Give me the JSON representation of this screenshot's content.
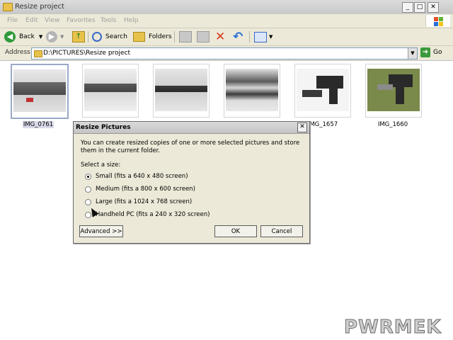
{
  "window": {
    "title": "Resize project",
    "btn_min": "_",
    "btn_max": "□",
    "btn_close": "✕"
  },
  "menu": [
    "File",
    "Edit",
    "View",
    "Favorites",
    "Tools",
    "Help"
  ],
  "toolbar": {
    "back_label": "Back",
    "search_label": "Search",
    "folders_label": "Folders"
  },
  "address": {
    "label": "Address",
    "path": "D:\\PICTURES\\Resize project",
    "go_label": "Go"
  },
  "thumbnails": [
    {
      "label": "IMG_0761",
      "selected": true
    },
    {
      "label": "",
      "selected": false
    },
    {
      "label": "",
      "selected": false
    },
    {
      "label": "",
      "selected": false
    },
    {
      "label": "IMG_1657",
      "selected": false
    },
    {
      "label": "IMG_1660",
      "selected": false
    }
  ],
  "dialog": {
    "title": "Resize Pictures",
    "close": "✕",
    "description": "You can create resized copies of one or more selected pictures and store them in the current folder.",
    "select_label": "Select a size:",
    "options": [
      {
        "label": "Small (fits a 640 x 480 screen)",
        "checked": true
      },
      {
        "label": "Medium (fits a 800 x 600 screen)",
        "checked": false
      },
      {
        "label": "Large (fits a 1024 x 768 screen)",
        "checked": false
      },
      {
        "label": "Handheld PC (fits a 240 x 320 screen)",
        "checked": false
      }
    ],
    "advanced_label": "Advanced >>",
    "ok_label": "OK",
    "cancel_label": "Cancel"
  },
  "watermark": "PWRMEK",
  "colors": {
    "accent_title": "#c8c8c8",
    "dialog_bg": "#ece9d8",
    "toolbar_bg": "#ece9d8"
  }
}
